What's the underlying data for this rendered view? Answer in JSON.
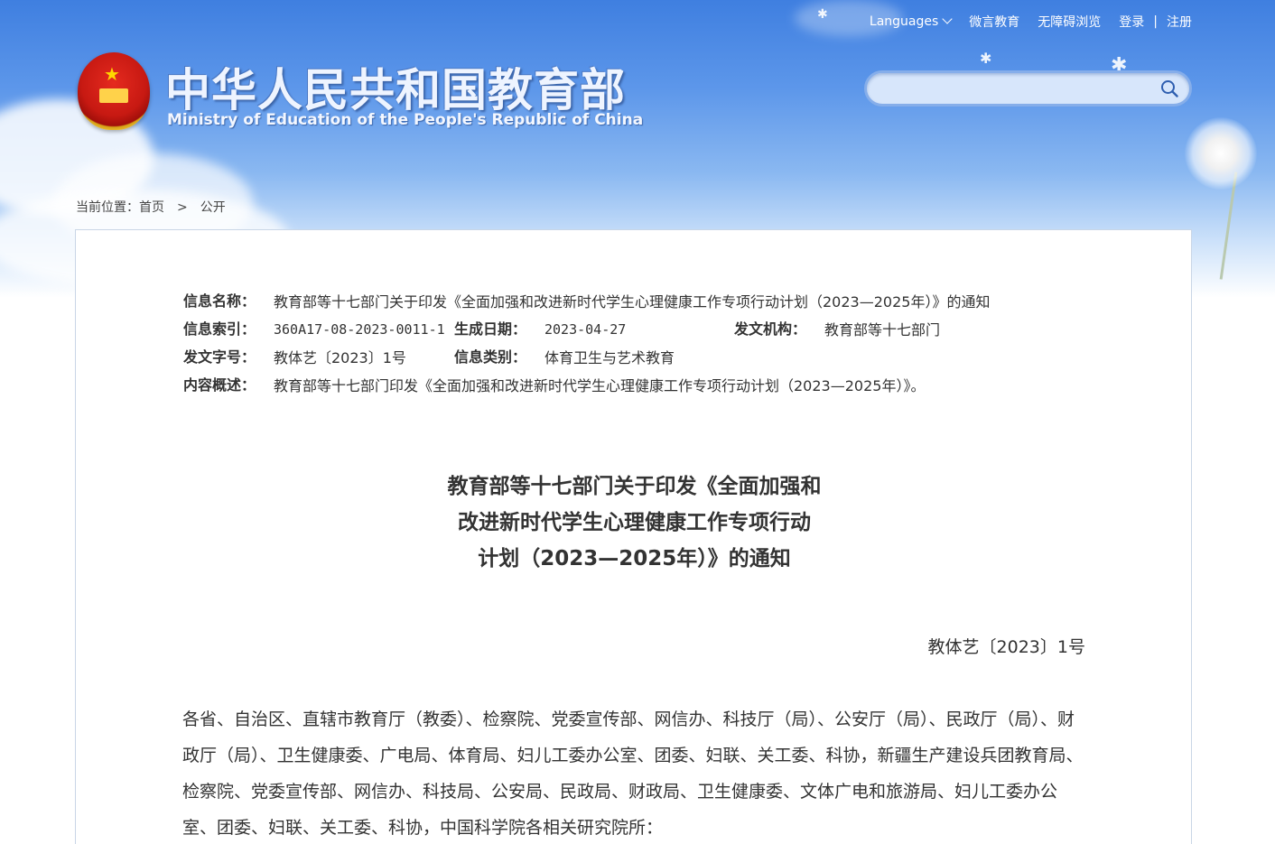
{
  "header": {
    "links": {
      "languages": "Languages",
      "weiyan": "微言教育",
      "accessible": "无障碍浏览",
      "login": "登录",
      "separator": "|",
      "register": "注册"
    },
    "logo_cn": "中华人民共和国教育部",
    "logo_en": "Ministry of Education of the People's Republic of China",
    "search_value": ""
  },
  "breadcrumb": {
    "prefix": "当前位置：",
    "home": "首页",
    "separator": ">",
    "current": "公开"
  },
  "meta": {
    "name_label": "信息名称：",
    "name_value": "教育部等十七部门关于印发《全面加强和改进新时代学生心理健康工作专项行动计划（2023—2025年）》的通知",
    "index_label": "信息索引：",
    "index_value": "360A17-08-2023-0011-1",
    "date_label": "生成日期：",
    "date_value": "2023-04-27",
    "org_label": "发文机构：",
    "org_value": "教育部等十七部门",
    "docno_label": "发文字号：",
    "docno_value": "教体艺〔2023〕1号",
    "category_label": "信息类别：",
    "category_value": "体育卫生与艺术教育",
    "summary_label": "内容概述：",
    "summary_value": "教育部等十七部门印发《全面加强和改进新时代学生心理健康工作专项行动计划（2023—2025年）》。"
  },
  "article": {
    "title_lines": [
      "教育部等十七部门关于印发《全面加强和",
      "改进新时代学生心理健康工作专项行动",
      "计划（2023—2025年）》的通知"
    ],
    "doc_number": "教体艺〔2023〕1号",
    "paragraph": "各省、自治区、直辖市教育厅（教委）、检察院、党委宣传部、网信办、科技厅（局）、公安厅（局）、民政厅（局）、财政厅（局）、卫生健康委、广电局、体育局、妇儿工委办公室、团委、妇联、关工委、科协，新疆生产建设兵团教育局、检察院、党委宣传部、网信办、科技局、公安局、民政局、财政局、卫生健康委、文体广电和旅游局、妇儿工委办公室、团委、妇联、关工委、科协，中国科学院各相关研究院所："
  },
  "colors": {
    "sky_top": "#3f7fe0",
    "panel_border": "#c9d6e6",
    "text": "#333333"
  }
}
